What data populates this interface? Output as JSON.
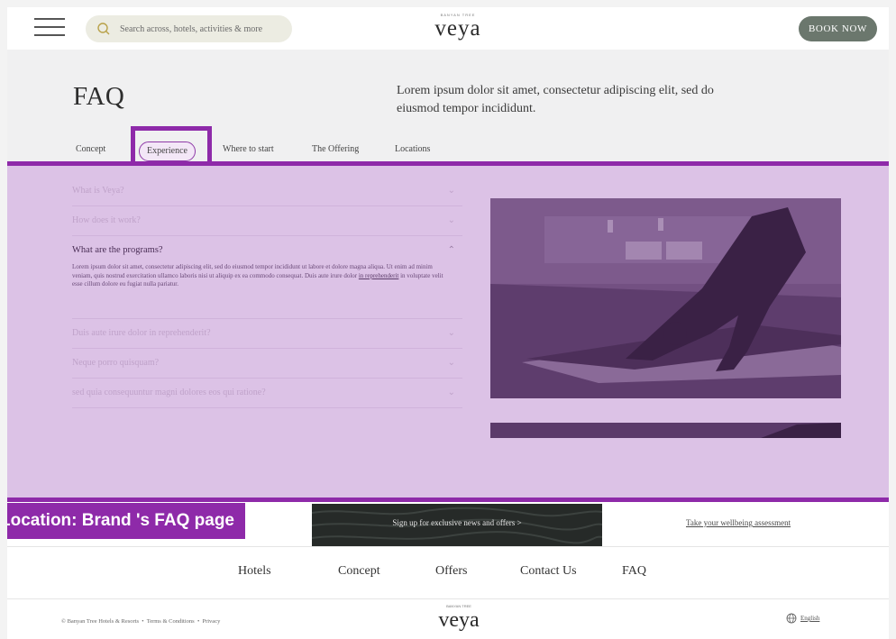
{
  "header": {
    "search_placeholder": "Search across, hotels, activities & more",
    "logo_small": "BANYAN TREE",
    "logo": "veya",
    "book_now": "BOOK NOW"
  },
  "faq": {
    "title": "FAQ",
    "intro": "Lorem ipsum dolor sit amet, consectetur adipiscing elit, sed do eiusmod tempor incididunt.",
    "tabs": [
      "Concept",
      "Experience",
      "Where to start",
      "The Offering",
      "Locations"
    ],
    "active_tab": "Experience",
    "questions": [
      "What is Veya?",
      "How does it work?",
      "What are the programs?",
      "Duis aute irure dolor in reprehenderit?",
      "Neque porro quisquam?",
      "sed quia consequuntur magni dolores eos qui ratione?"
    ],
    "answer_before": "Lorem ipsum dolor sit amet, consectetur adipiscing elit, sed do eiusmod tempor incididunt ut labore et dolore magna aliqua. Ut enim ad minim veniam, quis nostrud exercitation ullamco laboris nisi ut aliquip ex ea commodo consequat. Duis aute irure dolor ",
    "answer_link": "in reprehenderit",
    "answer_after": " in voluptate velit esse cillum dolore eu fugiat nulla pariatur."
  },
  "annotation": {
    "caption": "Location: Brand 's FAQ page"
  },
  "signup": {
    "label": "Sign up for exclusive news and offers  >",
    "assessment": "Take your wellbeing assessment"
  },
  "footer": {
    "nav": [
      "Hotels",
      "Concept",
      "Offers",
      "Contact Us",
      "FAQ"
    ],
    "copyright": "© Banyan Tree Hotels & Resorts",
    "terms": "Terms & Conditions",
    "privacy": "Privacy",
    "sep": "•",
    "logo_small": "BANYAN TREE",
    "logo": "veya",
    "language": "English"
  },
  "colors": {
    "accent": "#8e2aa9",
    "highlight_fill": "#dcc2e6",
    "book_button": "#6b776d"
  }
}
